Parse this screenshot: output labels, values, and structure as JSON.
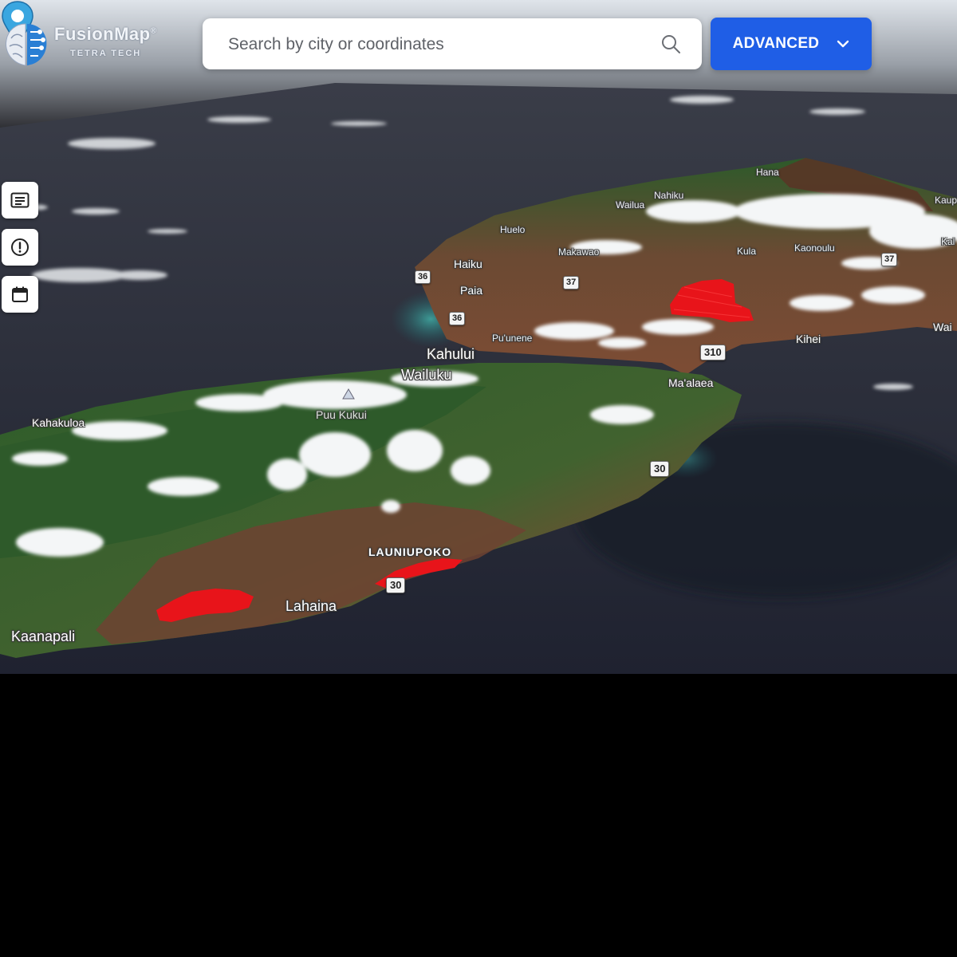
{
  "app": {
    "name": "FusionMap",
    "trademark": "®",
    "company": "TETRA TECH"
  },
  "search": {
    "placeholder": "Search by city or coordinates",
    "value": "",
    "icon": "search-icon"
  },
  "advanced_button": {
    "label": "ADVANCED",
    "icon": "chevron-down-icon"
  },
  "side_tools": [
    {
      "name": "legend-button",
      "icon": "list-icon"
    },
    {
      "name": "info-button",
      "icon": "alert-circle-icon"
    },
    {
      "name": "calendar-button",
      "icon": "calendar-icon"
    }
  ],
  "map": {
    "places": {
      "kaanapali": "Kaanapali",
      "lahaina": "Lahaina",
      "launiupoko": "LAUNIUPOKO",
      "kahakuloa": "Kahakuloa",
      "puu_kukui": "Puu Kukui",
      "wailuku": "Wailuku",
      "kahului": "Kahului",
      "puunene": "Pu'unene",
      "maalaea": "Ma'alaea",
      "kihei": "Kihei",
      "paia": "Paia",
      "haiku": "Haiku",
      "huelo": "Huelo",
      "makawao": "Makawao",
      "kula": "Kula",
      "kaonoulu": "Kaonoulu",
      "wailua": "Wailua",
      "nahiku": "Nahiku",
      "hana": "Hana",
      "kaupo": "Kaup",
      "kahikinui": "Kal",
      "wailea": "Wai"
    },
    "routes": {
      "r36a": "36",
      "r36b": "36",
      "r37a": "37",
      "r37b": "37",
      "r310": "310",
      "r30a": "30",
      "r30b": "30"
    },
    "colors": {
      "ocean": "#2b2f3d",
      "fire_burn_area": "#e8141a",
      "pin": "#3aa6e0",
      "vegetation": "#2f5a2c",
      "dry_land": "#7a4a32"
    },
    "marker": {
      "icon": "map-pin-icon"
    }
  }
}
